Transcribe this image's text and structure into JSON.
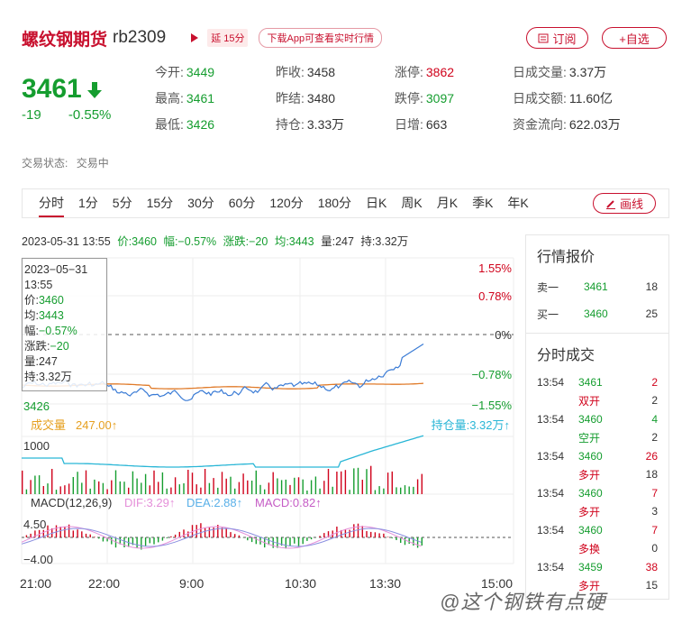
{
  "header": {
    "name": "螺纹钢期货",
    "code": "rb2309",
    "delay_badge": "延 15分",
    "download": "下载App可查看实时行情",
    "subscribe": "订阅",
    "add_watch": "+自选"
  },
  "quote": {
    "price": "3461",
    "change": "-19",
    "change_pct": "-0.55%"
  },
  "stats": [
    {
      "label": "今开:",
      "value": "3449",
      "color": "green"
    },
    {
      "label": "昨收:",
      "value": "3458",
      "color": "dark"
    },
    {
      "label": "涨停:",
      "value": "3862",
      "color": "red"
    },
    {
      "label": "日成交量:",
      "value": "3.37万",
      "color": "dark"
    },
    {
      "label": "最高:",
      "value": "3461",
      "color": "green"
    },
    {
      "label": "昨结:",
      "value": "3480",
      "color": "dark"
    },
    {
      "label": "跌停:",
      "value": "3097",
      "color": "green"
    },
    {
      "label": "日成交额:",
      "value": "11.60亿",
      "color": "dark"
    },
    {
      "label": "最低:",
      "value": "3426",
      "color": "green"
    },
    {
      "label": "持仓:",
      "value": "3.33万",
      "color": "dark"
    },
    {
      "label": "日增:",
      "value": "663",
      "color": "dark"
    },
    {
      "label": "资金流向:",
      "value": "622.03万",
      "color": "dark"
    }
  ],
  "status": {
    "label": "交易状态:",
    "value": "交易中"
  },
  "tabs": [
    "分时",
    "1分",
    "5分",
    "15分",
    "30分",
    "60分",
    "120分",
    "180分",
    "日K",
    "周K",
    "月K",
    "季K",
    "年K"
  ],
  "draw_button": "画线",
  "info_bar": {
    "datetime": "2023-05-31 13:55",
    "price": "价:3460",
    "range": "幅:−0.57%",
    "diff": "涨跌:−20",
    "avg": "均:3443",
    "vol": "量:247",
    "hold": "持:3.32万"
  },
  "tooltip": {
    "date": "2023−05−31",
    "time": "13:55",
    "price_l": "价:",
    "price": "3460",
    "avg_l": "均:",
    "avg": "3443",
    "range_l": "幅:",
    "range": "−0.57%",
    "diff_l": "涨跌:",
    "diff": "−20",
    "vol_l": "量:",
    "vol": "247",
    "hold_l": "持:",
    "hold": "3.32万"
  },
  "chart_labels": {
    "pct_top": "1.55%",
    "pct_2": "0.78%",
    "pct_mid": "0%",
    "pct_4": "−0.78%",
    "pct_bot": "−1.55%",
    "price_low": "3426",
    "vol_title": "成交量",
    "vol_val": "247.00↑",
    "hold_title": "持仓量:3.32万↑",
    "vol_axis": "1000",
    "macd_title": "MACD(12,26,9)",
    "dif": "DIF:3.29↑",
    "dea": "DEA:2.88↑",
    "macd": "MACD:0.82↑",
    "macd_top": "4.50",
    "macd_bot": "−4.00"
  },
  "xaxis": [
    "21:00",
    "22:00",
    "9:00",
    "10:30",
    "13:30",
    "15:00"
  ],
  "quote_panel": {
    "title": "行情报价",
    "rows": [
      {
        "label": "卖一",
        "price": "3461",
        "qty": "18"
      },
      {
        "label": "买一",
        "price": "3460",
        "qty": "25"
      }
    ]
  },
  "trade_panel": {
    "title": "分时成交",
    "rows": [
      {
        "time": "13:54",
        "price": "3461",
        "vol": "2",
        "type": "双开",
        "oi": "2",
        "pc": "green",
        "vc": "red",
        "tc": "red"
      },
      {
        "time": "13:54",
        "price": "3460",
        "vol": "4",
        "type": "空开",
        "oi": "2",
        "pc": "green",
        "vc": "green",
        "tc": "green"
      },
      {
        "time": "13:54",
        "price": "3460",
        "vol": "26",
        "type": "多开",
        "oi": "18",
        "pc": "green",
        "vc": "red",
        "tc": "red"
      },
      {
        "time": "13:54",
        "price": "3460",
        "vol": "7",
        "type": "多开",
        "oi": "3",
        "pc": "green",
        "vc": "red",
        "tc": "red"
      },
      {
        "time": "13:54",
        "price": "3460",
        "vol": "7",
        "type": "多换",
        "oi": "0",
        "pc": "green",
        "vc": "red",
        "tc": "red"
      },
      {
        "time": "13:54",
        "price": "3459",
        "vol": "38",
        "type": "多开",
        "oi": "15",
        "pc": "green",
        "vc": "red",
        "tc": "red"
      }
    ]
  },
  "watermark": "@这个钢铁有点硬",
  "colors": {
    "red": "#d0021b",
    "green": "#159d2f",
    "avg_line": "#e07b2a",
    "price_line": "#3a7bd5",
    "hold_line": "#29b6d6"
  }
}
